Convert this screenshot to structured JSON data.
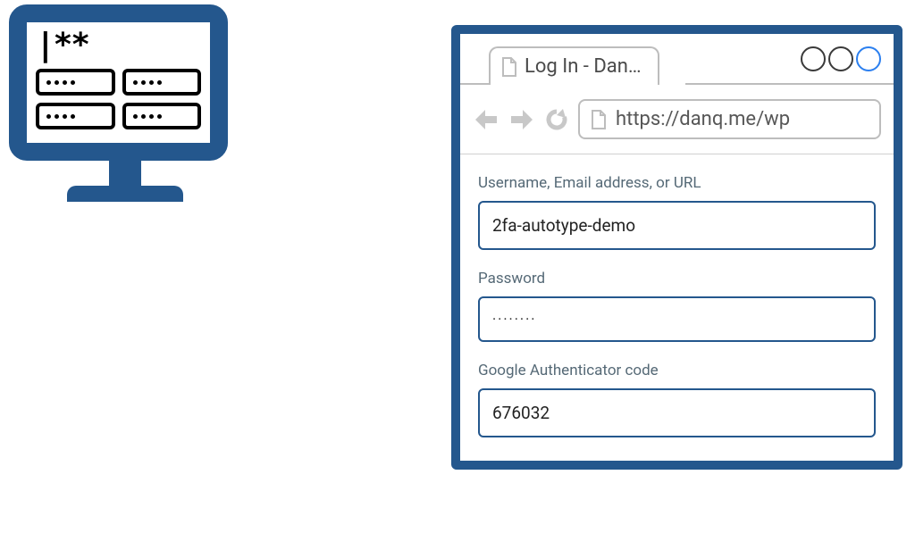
{
  "monitor": {
    "password_indicator": "|**"
  },
  "browser": {
    "tab": {
      "title": "Log In - Dan…"
    },
    "url": "https://danq.me/wp",
    "form": {
      "username_label": "Username, Email address, or URL",
      "username_value": "2fa-autotype-demo",
      "password_label": "Password",
      "password_value": "········",
      "totp_label": "Google Authenticator code",
      "totp_value": "676032"
    }
  }
}
